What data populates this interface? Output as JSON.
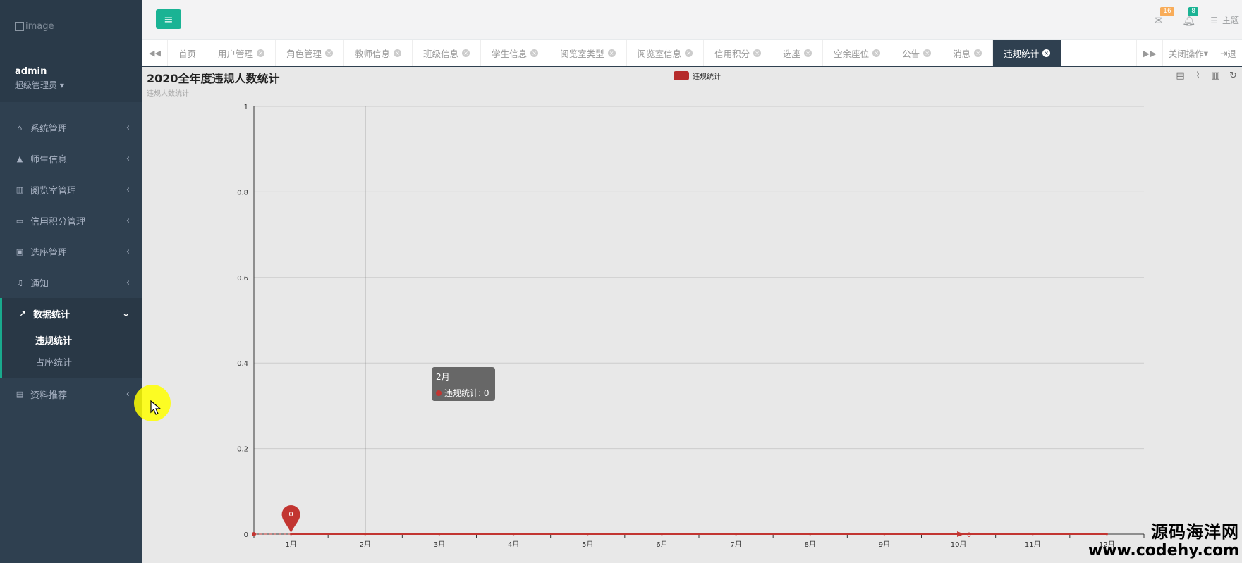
{
  "sidebar": {
    "logo_text": "image",
    "user_name": "admin",
    "user_role": "超级管理员",
    "menu": [
      {
        "label": "系统管理",
        "icon": "home-icon"
      },
      {
        "label": "师生信息",
        "icon": "graduation-cap-icon"
      },
      {
        "label": "阅览室管理",
        "icon": "book-open-icon"
      },
      {
        "label": "信用积分管理",
        "icon": "credit-card-icon"
      },
      {
        "label": "选座管理",
        "icon": "calendar-check-icon"
      },
      {
        "label": "通知",
        "icon": "bell-icon"
      },
      {
        "label": "数据统计",
        "icon": "line-chart-icon",
        "expanded": true,
        "children": [
          "违规统计",
          "占座统计"
        ],
        "selected_child": "违规统计"
      },
      {
        "label": "资料推荐",
        "icon": "book-icon"
      }
    ]
  },
  "topbar": {
    "mail_count": "16",
    "bell_count": "8",
    "theme_label": "主题"
  },
  "tabs": {
    "items": [
      "首页",
      "用户管理",
      "角色管理",
      "教师信息",
      "班级信息",
      "学生信息",
      "阅览室类型",
      "阅览室信息",
      "信用积分",
      "选座",
      "空余座位",
      "公告",
      "消息",
      "违规统计"
    ],
    "active": "违规统计",
    "close_ops": "关闭操作",
    "logout": "退"
  },
  "chart_data": {
    "type": "line",
    "title": "2020全年度违规人数统计",
    "subtitle": "违规人数统计",
    "categories": [
      "1月",
      "2月",
      "3月",
      "4月",
      "5月",
      "6月",
      "7月",
      "8月",
      "9月",
      "10月",
      "11月",
      "12月"
    ],
    "series": [
      {
        "name": "违规统计",
        "values": [
          0,
          0,
          0,
          0,
          0,
          0,
          0,
          0,
          0,
          0,
          0,
          0
        ],
        "color": "#c23531"
      }
    ],
    "ylim": [
      0,
      1
    ],
    "yticks": [
      "0",
      "0.2",
      "0.4",
      "0.6",
      "0.8",
      "1"
    ],
    "markpoint_label": "0",
    "markline_label": "0",
    "legend": "top-center",
    "grid": true
  },
  "tooltip": {
    "title": "2月",
    "series_line": "违规统计: 0"
  },
  "watermark": {
    "text_cn": "源码海洋网",
    "url": "www.codehy.com"
  }
}
